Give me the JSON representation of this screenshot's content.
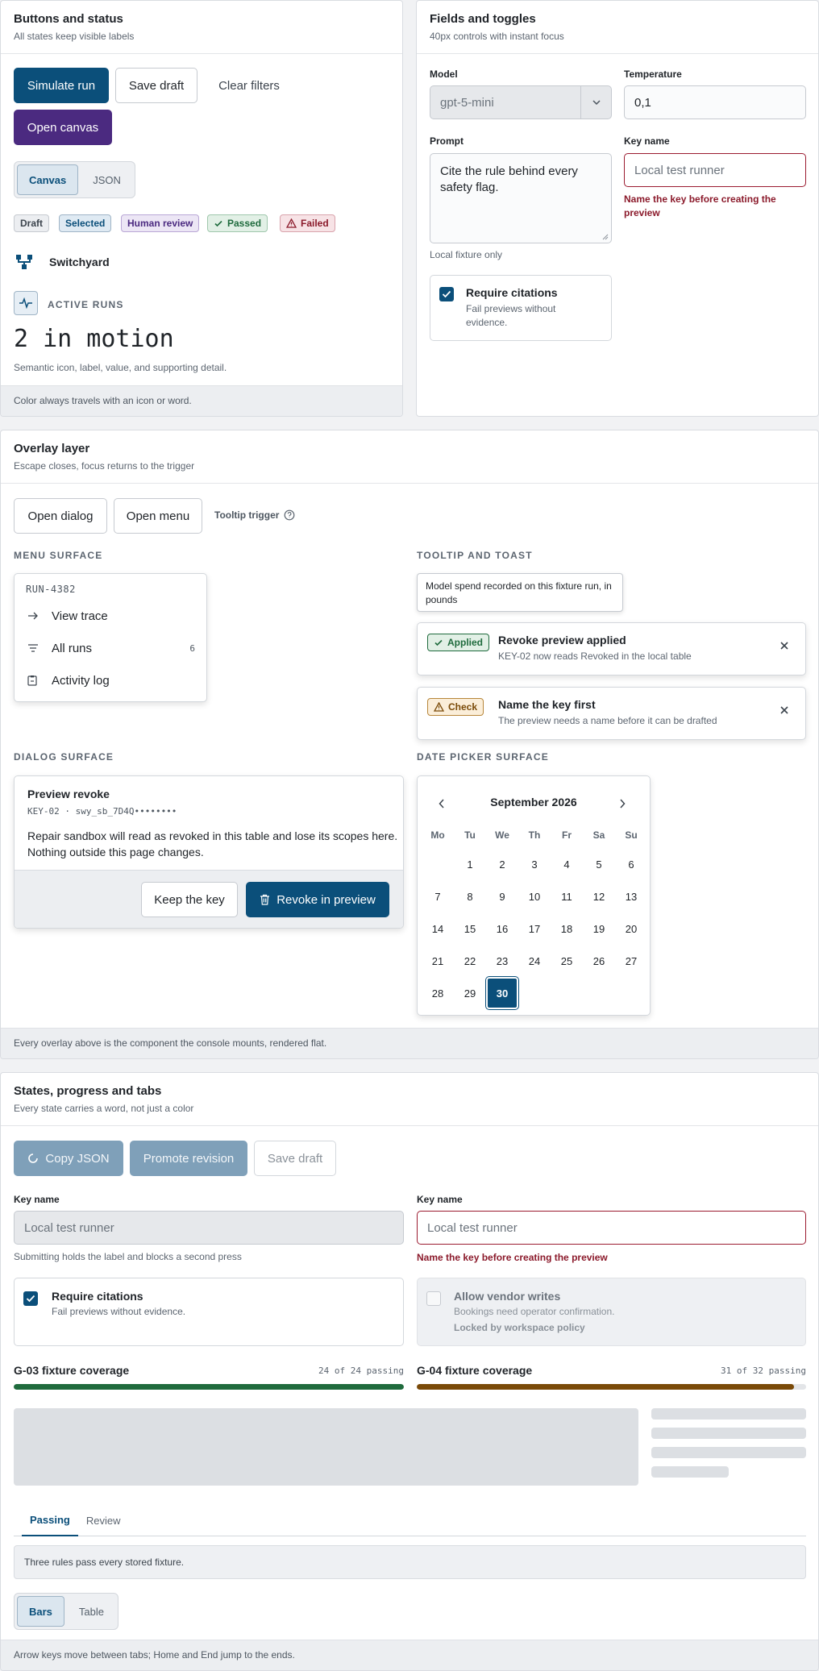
{
  "buttons_panel": {
    "title": "Buttons and status",
    "subtitle": "All states keep visible labels",
    "simulate_run": "Simulate run",
    "save_draft": "Save draft",
    "clear_filters": "Clear filters",
    "open_canvas": "Open canvas",
    "view_toggle": [
      "Canvas",
      "JSON"
    ],
    "badges": {
      "draft": "Draft",
      "selected": "Selected",
      "human_review": "Human review",
      "passed": "Passed",
      "failed": "Failed"
    },
    "brand_name": "Switchyard",
    "metric_label": "ACTIVE RUNS",
    "metric_value": "2 in motion",
    "metric_detail": "Semantic icon, label, value, and supporting detail.",
    "footer": "Color always travels with an icon or word."
  },
  "fields_panel": {
    "title": "Fields and toggles",
    "subtitle": "40px controls with instant focus",
    "model_label": "Model",
    "model_value": "gpt-5-mini",
    "temperature_label": "Temperature",
    "temperature_value": "0,1",
    "prompt_label": "Prompt",
    "prompt_value": "Cite the rule behind every safety flag.",
    "prompt_hint": "Local fixture only",
    "key_name_label": "Key name",
    "key_name_placeholder": "Local test runner",
    "key_name_error": "Name the key before creating the preview",
    "require_citations_title": "Require citations",
    "require_citations_desc": "Fail previews without evidence."
  },
  "overlay_panel": {
    "title": "Overlay layer",
    "subtitle": "Escape closes, focus returns to the trigger",
    "open_dialog": "Open dialog",
    "open_menu": "Open menu",
    "tooltip_trigger": "Tooltip trigger",
    "menu_surface_label": "MENU SURFACE",
    "menu": {
      "header": "RUN-4382",
      "view_trace": "View trace",
      "all_runs": "All runs",
      "all_runs_count": "6",
      "activity_log": "Activity log"
    },
    "tooltip_toast_label": "TOOLTIP AND TOAST",
    "tooltip_text": "Model spend recorded on this fixture run, in pounds",
    "toast_applied": {
      "tag": "Applied",
      "title": "Revoke preview applied",
      "body": "KEY-02 now reads Revoked in the local table"
    },
    "toast_check": {
      "tag": "Check",
      "title": "Name the key first",
      "body": "The preview needs a name before it can be drafted"
    },
    "dialog_surface_label": "DIALOG SURFACE",
    "dialog": {
      "title": "Preview revoke",
      "key_line": "KEY-02 · swy_sb_7D4Q••••••••",
      "body": "Repair sandbox will read as revoked in this table and lose its scopes here. Nothing outside this page changes.",
      "keep": "Keep the key",
      "revoke": "Revoke in preview"
    },
    "date_picker_label": "DATE PICKER SURFACE",
    "calendar": {
      "month": "September 2026",
      "weekdays": [
        "Mo",
        "Tu",
        "We",
        "Th",
        "Fr",
        "Sa",
        "Su"
      ],
      "weeks": [
        [
          "",
          "1",
          "2",
          "3",
          "4",
          "5",
          "6"
        ],
        [
          "7",
          "8",
          "9",
          "10",
          "11",
          "12",
          "13"
        ],
        [
          "14",
          "15",
          "16",
          "17",
          "18",
          "19",
          "20"
        ],
        [
          "21",
          "22",
          "23",
          "24",
          "25",
          "26",
          "27"
        ],
        [
          "28",
          "29",
          "30",
          "",
          "",
          "",
          ""
        ]
      ],
      "selected": "30"
    },
    "footer": "Every overlay above is the component the console mounts, rendered flat."
  },
  "states_panel": {
    "title": "States, progress and tabs",
    "subtitle": "Every state carries a word, not just a color",
    "copy_json": "Copy JSON",
    "promote_revision": "Promote revision",
    "save_draft": "Save draft",
    "key_name_label": "Key name",
    "key_name_placeholder": "Local test runner",
    "submitting_hint": "Submitting holds the label and blocks a second press",
    "key_name_error": "Name the key before creating the preview",
    "require_citations_title": "Require citations",
    "require_citations_desc": "Fail previews without evidence.",
    "vendor_writes_title": "Allow vendor writes",
    "vendor_writes_desc": "Bookings need operator confirmation.",
    "vendor_writes_lock": "Locked by workspace policy",
    "coverage": [
      {
        "title": "G-03 fixture coverage",
        "count": "24 of 24 passing",
        "fraction": 1.0,
        "color": "#1f6b3d"
      },
      {
        "title": "G-04 fixture coverage",
        "count": "31 of 32 passing",
        "fraction": 0.96875,
        "color": "#7a4a08"
      }
    ],
    "tabs": [
      "Passing",
      "Review"
    ],
    "tab_panel_text": "Three rules pass every stored fixture.",
    "view_toggle": [
      "Bars",
      "Table"
    ],
    "footer": "Arrow keys move between tabs; Home and End jump to the ends."
  },
  "colors": {
    "primary": "#0b4f7a",
    "purple": "#4b2a80",
    "error": "#8b1a2b",
    "success": "#1f6b3d",
    "warning": "#7a4a08"
  }
}
